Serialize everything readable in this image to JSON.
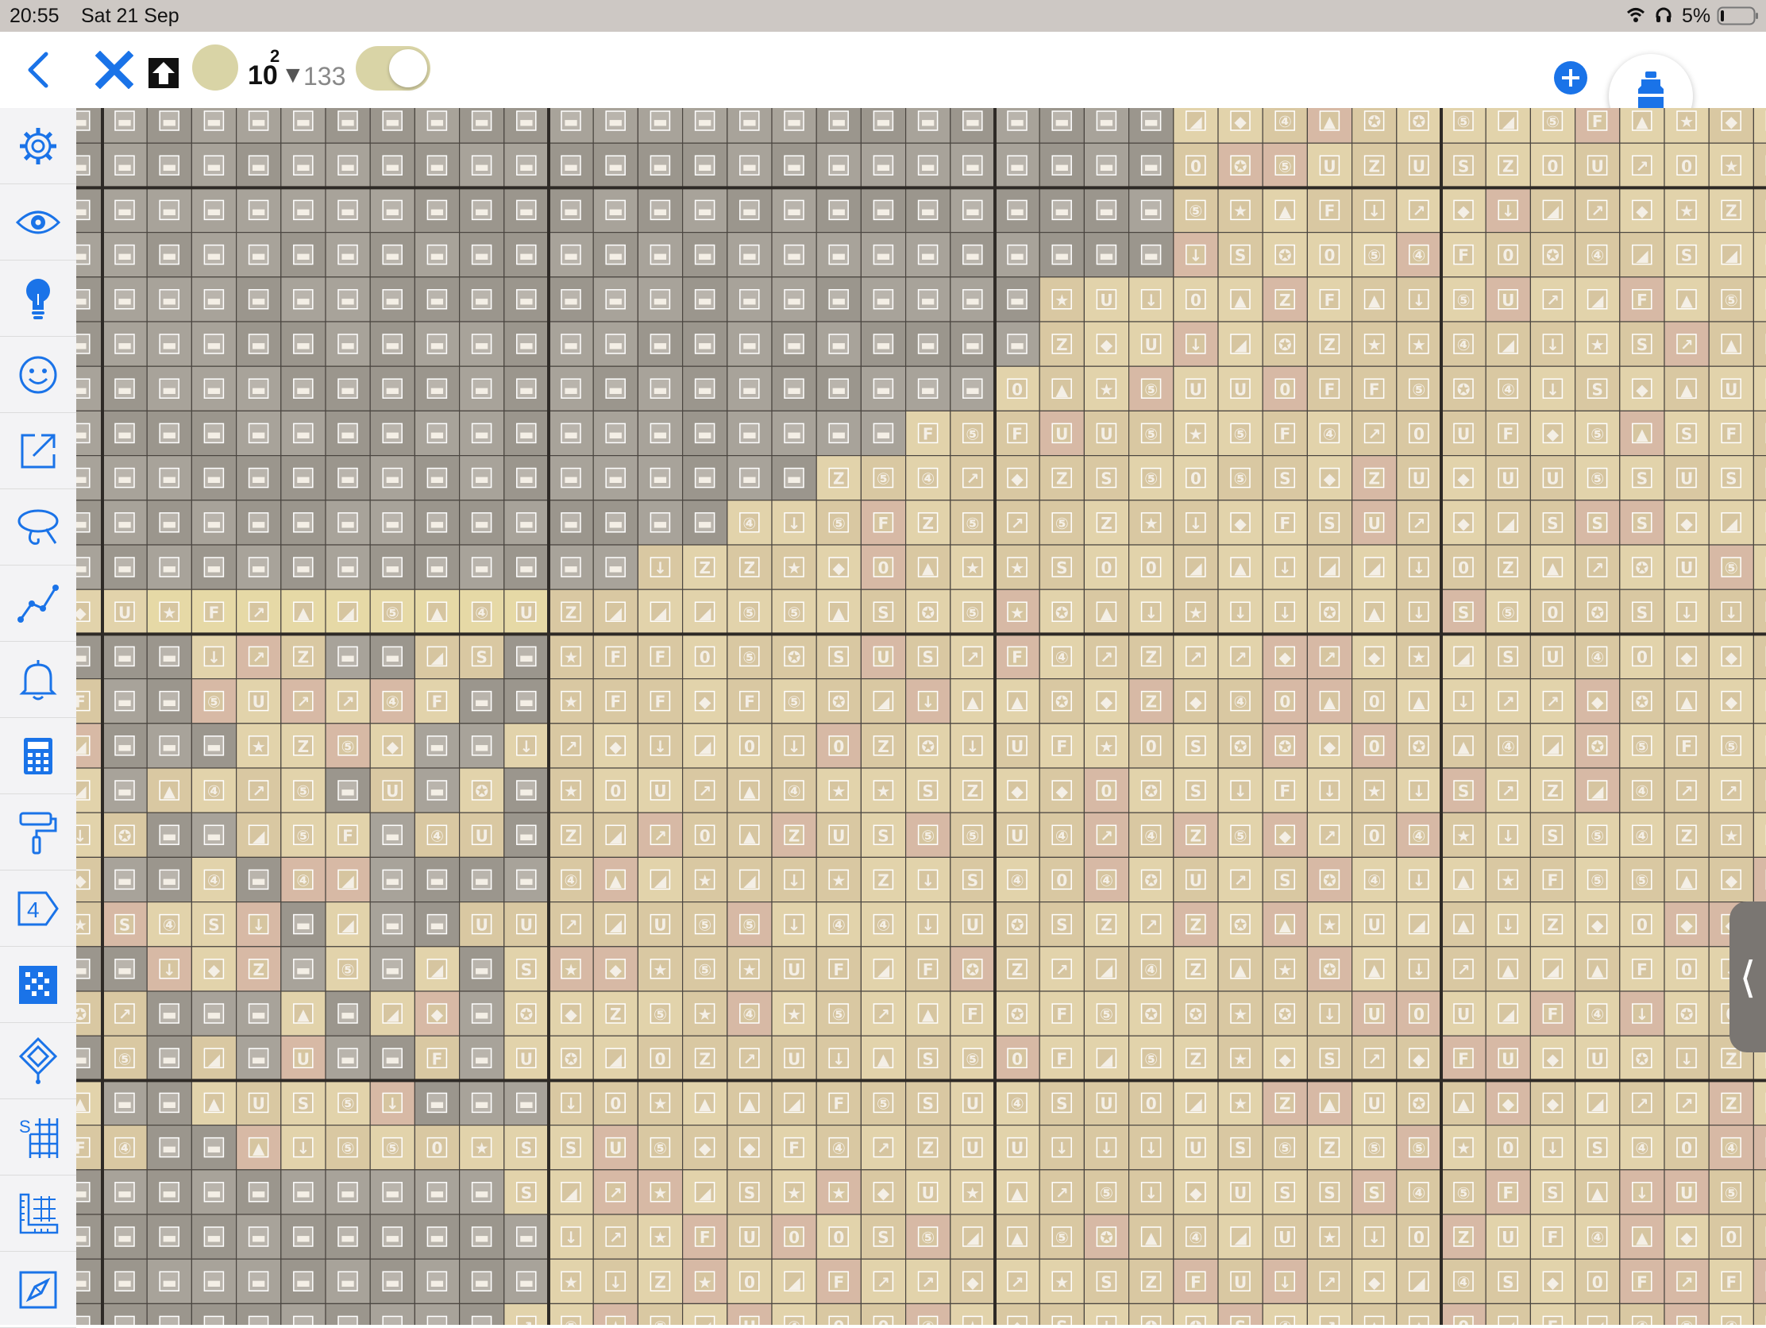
{
  "status_bar": {
    "time": "20:55",
    "date": "Sat 21 Sep",
    "battery": "5%",
    "icons": [
      "wifi-icon",
      "headphones-icon",
      "battery-icon"
    ]
  },
  "toolbar": {
    "back_icon": "chevron-left-icon",
    "tool_icon": "x-stitch-icon",
    "upload_icon": "upload-arrow-icon",
    "thread_color": "#d9d4a6",
    "thread_number": "10",
    "thread_superscript": "2",
    "remaining_symbol": "▼",
    "remaining_count": "133",
    "toggle_on": true,
    "add_icon": "plus-circle-icon",
    "bottle_icon": "thread-bottle-icon"
  },
  "sidebar": {
    "items": [
      {
        "name": "settings",
        "icon": "gear-icon"
      },
      {
        "name": "view",
        "icon": "eye-icon"
      },
      {
        "name": "hint",
        "icon": "lightbulb-icon"
      },
      {
        "name": "face",
        "icon": "smiley-icon"
      },
      {
        "name": "resize",
        "icon": "expand-icon"
      },
      {
        "name": "lasso",
        "icon": "lasso-icon"
      },
      {
        "name": "line",
        "icon": "line-chart-icon"
      },
      {
        "name": "notifications",
        "icon": "bell-icon"
      },
      {
        "name": "calculator",
        "icon": "calculator-icon"
      },
      {
        "name": "paint-roller",
        "icon": "paint-roller-icon"
      },
      {
        "name": "tag",
        "icon": "tag-4-icon",
        "label": "4"
      },
      {
        "name": "pattern-grid",
        "icon": "pattern-grid-icon"
      },
      {
        "name": "pin",
        "icon": "diamond-pin-icon"
      },
      {
        "name": "symbol-grid",
        "icon": "s-grid-icon",
        "label": "S"
      },
      {
        "name": "ruler",
        "icon": "ruler-grid-icon"
      },
      {
        "name": "compass",
        "icon": "compass-icon"
      }
    ]
  },
  "canvas": {
    "colors": {
      "grey": "#a8a39a",
      "dark_grey": "#9b968d",
      "tan": "#d9c8a2",
      "light_tan": "#e2d3ab",
      "pink_tan": "#d7b9a5",
      "yellow": "#e6d9a6",
      "grid_line": "#4a4540",
      "major_line": "#2e2a26"
    }
  },
  "palette_handle": {
    "icon": "chevron-left-icon",
    "label": "⟨"
  }
}
